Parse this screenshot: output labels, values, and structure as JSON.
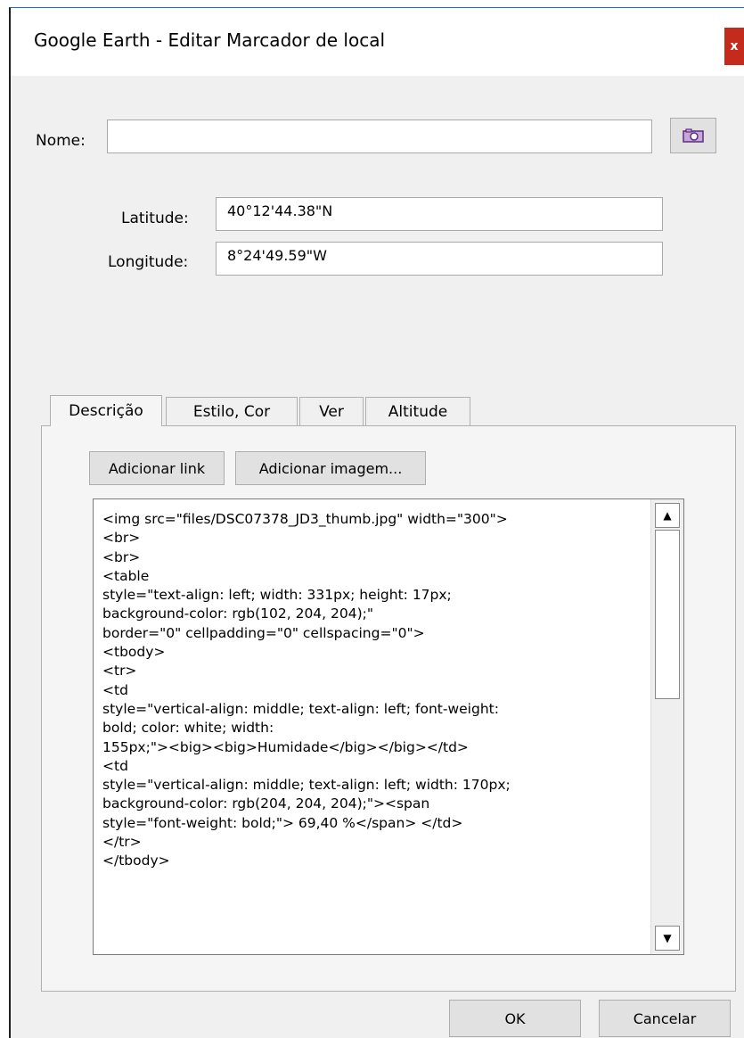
{
  "window": {
    "title": "Google Earth - Editar Marcador de local",
    "close_label": "x"
  },
  "form": {
    "name_label": "Nome:",
    "name_value": "",
    "latitude_label": "Latitude:",
    "latitude_value": "40°12'44.38\"N",
    "longitude_label": "Longitude:",
    "longitude_value": "8°24'49.59\"W"
  },
  "tabs": [
    {
      "label": "Descrição",
      "active": true
    },
    {
      "label": "Estilo, Cor",
      "active": false
    },
    {
      "label": "Ver",
      "active": false
    },
    {
      "label": "Altitude",
      "active": false
    }
  ],
  "description": {
    "add_link_label": "Adicionar link",
    "add_image_label": "Adicionar imagem...",
    "html_source": "<img src=\"files/DSC07378_JD3_thumb.jpg\" width=\"300\">\n<br>\n<br>\n<table\nstyle=\"text-align: left; width: 331px; height: 17px;\nbackground-color: rgb(102, 204, 204);\"\nborder=\"0\" cellpadding=\"0\" cellspacing=\"0\">\n<tbody>\n<tr>\n<td\nstyle=\"vertical-align: middle; text-align: left; font-weight:\nbold; color: white; width:\n155px;\"><big><big>Humidade</big></big></td>\n<td\nstyle=\"vertical-align: middle; text-align: left; width: 170px;\nbackground-color: rgb(204, 204, 204);\"><span\nstyle=\"font-weight: bold;\"> 69,40 %</span> </td>\n</tr>\n</tbody>"
  },
  "footer": {
    "ok_label": "OK",
    "cancel_label": "Cancelar"
  }
}
